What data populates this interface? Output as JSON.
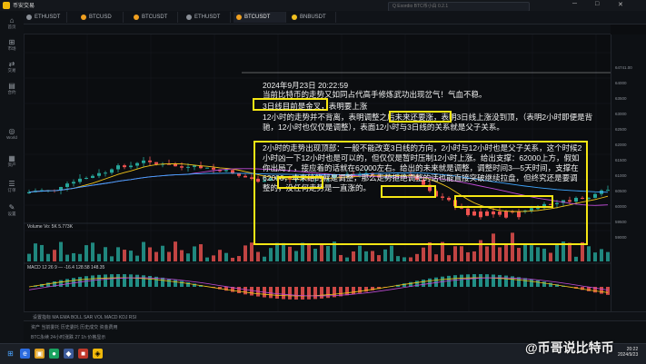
{
  "app": {
    "title": "币安交易",
    "search_placeholder": "Q  Exordio BTC币小白 0.2.1"
  },
  "tabs": [
    {
      "label": "ETHUSDT",
      "color": "#8a8f97",
      "active": false
    },
    {
      "label": "BTCUSD",
      "color": "#f0a020",
      "active": false
    },
    {
      "label": "BTCUSDT",
      "color": "#f0a020",
      "active": false
    },
    {
      "label": "ETHUSDT",
      "color": "#8a8f97",
      "active": false
    },
    {
      "label": "BTCUSDT",
      "color": "#f0a020",
      "active": true
    },
    {
      "label": "BNBUSDT",
      "color": "#f0c020",
      "active": false
    }
  ],
  "sidebar": [
    {
      "icon": "⌂",
      "label": "首页"
    },
    {
      "icon": "⊞",
      "label": "市场"
    },
    {
      "icon": "⇄",
      "label": "交易"
    },
    {
      "icon": "▤",
      "label": "合约"
    },
    {
      "icon": "◎",
      "label": "World"
    },
    {
      "icon": "▦",
      "label": "资产"
    },
    {
      "icon": "☰",
      "label": "订单"
    },
    {
      "icon": "✎",
      "label": "设置"
    }
  ],
  "axis_prices": [
    "64741.00",
    "64000",
    "63500",
    "63000",
    "62500",
    "62000",
    "61500",
    "61000",
    "60500",
    "60000",
    "59500",
    "59000"
  ],
  "annotation": {
    "date": "2024年9月23日 20:22:59",
    "line1": "当前比特币的走势又如同占代高手修炼武功出现岔气！气血不稳。",
    "box1": "3日线目前是金叉，表明要上涨",
    "para1": "12小时的走势并不背离，表明调整之后未来还要涨，表明3日线上涨没到顶，（表明2小时即便是背驰，12小时也仅仅是调整），表面12小时与3日线的关系就是父子关系。",
    "box2": "2小时的走势出现顶部：一般不能改变3日线的方向，2小时与12小时也是父子关系，这个时候2小时凶一下12小时也是可以的，但仅仅是暂时压制12小时上涨。给出支撑：62000上方，假如你出局了，接应着的话就在62000左右。给出的未来就是调整，调整时间3—5天时间，支撑在62000，本来给的就是调整，那么走势拒绝调整的话也能直接突破继续拉盘，但终究还是要调整的，没任何走势是一直涨的。"
  },
  "legends": {
    "volume": "Volume  Vo: 5K  5.773K",
    "macd": "MACD  12 26 9  —  -16.4  128.58  148.35"
  },
  "indicator_tabs": "设置指标  MA  EMA  BOLL  SAR  VOL  MACD  KDJ  RSI",
  "bottom_panel": {
    "row1": "资产      当前委托      历史委托      历史成交      资金费用",
    "row2": "BTC永续  24小时涨跌  27  1h 价格显示"
  },
  "watermark": "@币哥说比特币",
  "clock": {
    "time": "20:22",
    "date": "2024/9/23"
  },
  "colors": {
    "up": "#26a69a",
    "down": "#ef5350",
    "highlight": "#f5e614"
  }
}
